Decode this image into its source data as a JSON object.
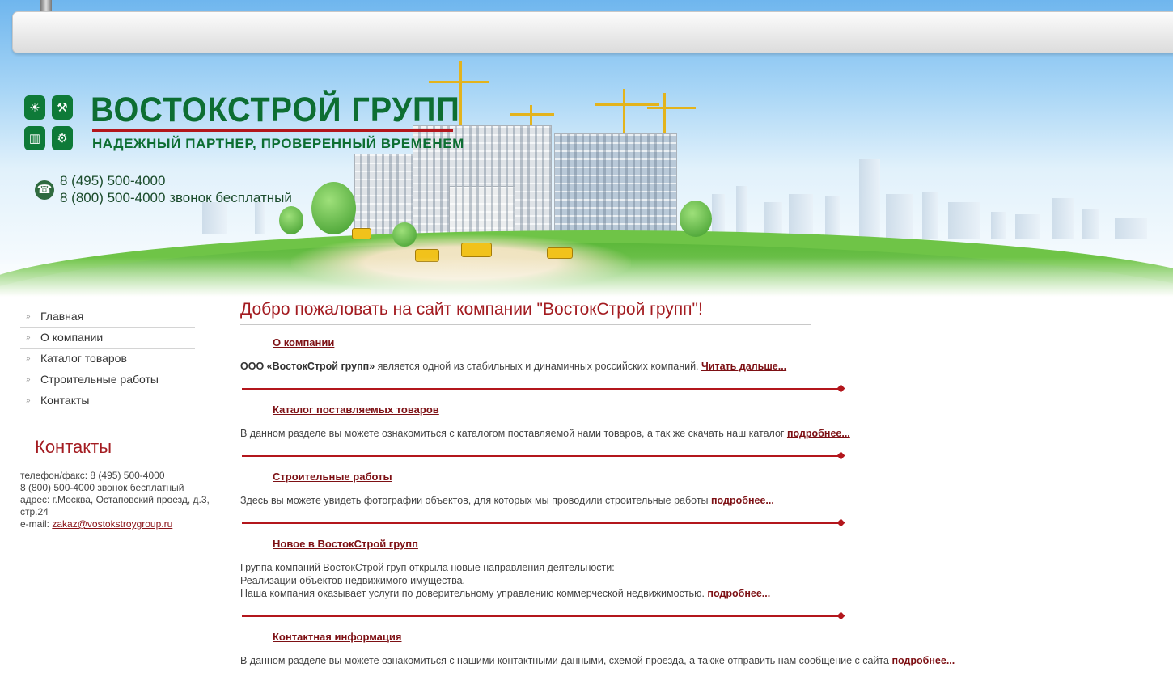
{
  "header": {
    "brand_title": "ВОСТОКСТРОЙ ГРУПП",
    "brand_tagline": "НАДЕЖНЫЙ ПАРТНЕР, ПРОВЕРЕННЫЙ ВРЕМЕНЕМ",
    "phone_1": "8 (495) 500-4000",
    "phone_2": "8 (800) 500-4000 звонок бесплатный",
    "phone_icon": "phone-icon"
  },
  "nav": {
    "items": [
      {
        "label": "Главная"
      },
      {
        "label": "О компании"
      },
      {
        "label": "Каталог товаров"
      },
      {
        "label": "Строительные работы"
      },
      {
        "label": "Контакты"
      }
    ],
    "bullet_icon": "double-chevron-icon"
  },
  "contacts": {
    "title": "Контакты",
    "phone_fax": "телефон/факс: 8 (495) 500-4000",
    "phone_free": "8 (800) 500-4000 звонок бесплатный",
    "address": "адрес: г.Москва, Остаповский проезд, д.3, стр.24",
    "email_label": "e-mail:",
    "email": "zakaz@vostokstroygroup.ru"
  },
  "main": {
    "welcome": "Добро пожаловать на сайт компании \"ВостокСтрой групп\"!",
    "sections": [
      {
        "title": "О компании",
        "company_name": "ООО «ВостокСтрой групп»",
        "text": " является одной из стабильных и динамичных российских компаний. ",
        "more": "Читать дальше..."
      },
      {
        "title": "Каталог поставляемых товаров",
        "text": "В данном разделе вы можете ознакомиться с каталогом поставляемой нами товаров, а так же скачать наш каталог ",
        "more": "подробнее..."
      },
      {
        "title": "Строительные работы",
        "text": "Здесь вы можете увидеть фотографии объектов, для которых мы проводили строительные работы ",
        "more": "подробнее..."
      },
      {
        "title": "Новое в ВостокСтрой групп",
        "line_1": "Группа компаний ВостокСтрой груп открыла новые направления деятельности:",
        "line_2": "Реализации объектов недвижимого имущества.",
        "line_3": "Наша компания оказывает услуги по доверительному управлению коммерческой недвижимостью. ",
        "more": "подробнее..."
      },
      {
        "title": "Контактная информация",
        "text": "В данном разделе вы можете ознакомиться с нашими контактными данными, схемой проезда, а также отправить нам сообщение с сайта ",
        "more": "подробнее..."
      }
    ]
  },
  "colors": {
    "brand_green": "#0d6e32",
    "accent_red": "#a31b20",
    "link_dark_red": "#7d1014"
  }
}
